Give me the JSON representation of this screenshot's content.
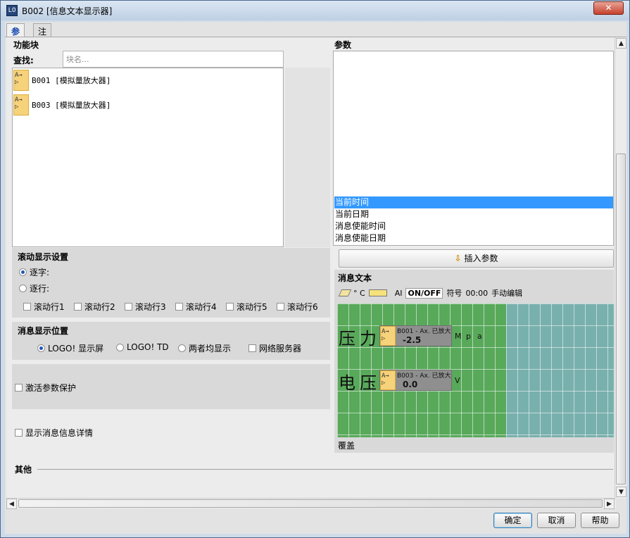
{
  "window": {
    "icon_text": "LO",
    "title": "B002 [信息文本显示器]",
    "close_symbol": "✕"
  },
  "tabs": [
    {
      "label": "参数"
    },
    {
      "label": "注释"
    }
  ],
  "function_blocks": {
    "title": "功能块",
    "search_label": "查找:",
    "search_placeholder": "块名...",
    "items": [
      {
        "label": "B001 [模拟量放大器]",
        "icon_text": "A→ ▷"
      },
      {
        "label": "B003 [模拟量放大器]",
        "icon_text": "A→ ▷"
      }
    ]
  },
  "scroll_settings": {
    "title": "滚动显示设置",
    "mode_char": "逐字:",
    "mode_line": "逐行:",
    "selected_mode": "逐字",
    "lines": [
      "滚动行1",
      "滚动行2",
      "滚动行3",
      "滚动行4",
      "滚动行5",
      "滚动行6"
    ]
  },
  "display_position": {
    "title": "消息显示位置",
    "options": [
      "LOGO! 显示屏",
      "LOGO! TD",
      "两者均显示"
    ],
    "selected": "LOGO! 显示屏",
    "web_server": "网络服务器"
  },
  "activate_protection": "激活参数保护",
  "show_details": "显示消息信息详情",
  "parameters": {
    "title": "参数",
    "list": [
      "当前时间",
      "当前日期",
      "消息使能时间",
      "消息使能日期"
    ],
    "selected_index": 0,
    "insert_button": "插入参数"
  },
  "message_text": {
    "title": "消息文本",
    "toolbar": {
      "degree": "° C",
      "ai": "AI",
      "onoff": "ON/OFF",
      "symbol": "符号",
      "time": "00:00",
      "manual_edit": "手动编辑"
    },
    "row1": {
      "chars": [
        "压",
        "力"
      ],
      "param_name": "B001 - Ax.",
      "param_type": "已放大",
      "param_value": "-2.5",
      "unit_chars": [
        "M",
        "p",
        "a"
      ]
    },
    "row2": {
      "chars": [
        "电",
        "压"
      ],
      "param_name": "B003 - Ax.",
      "param_type": "已放大",
      "param_value": "0.0",
      "unit_chars": [
        "V"
      ]
    },
    "overwrite_label": "覆盖"
  },
  "other": {
    "title": "其他"
  },
  "buttons": {
    "ok": "确定",
    "cancel": "取消",
    "help": "帮助"
  },
  "colors": {
    "grid_green": "#58a95a",
    "grid_teal": "#78b0ad",
    "selection": "#3399ff",
    "fb_icon": "#f6d27a"
  }
}
